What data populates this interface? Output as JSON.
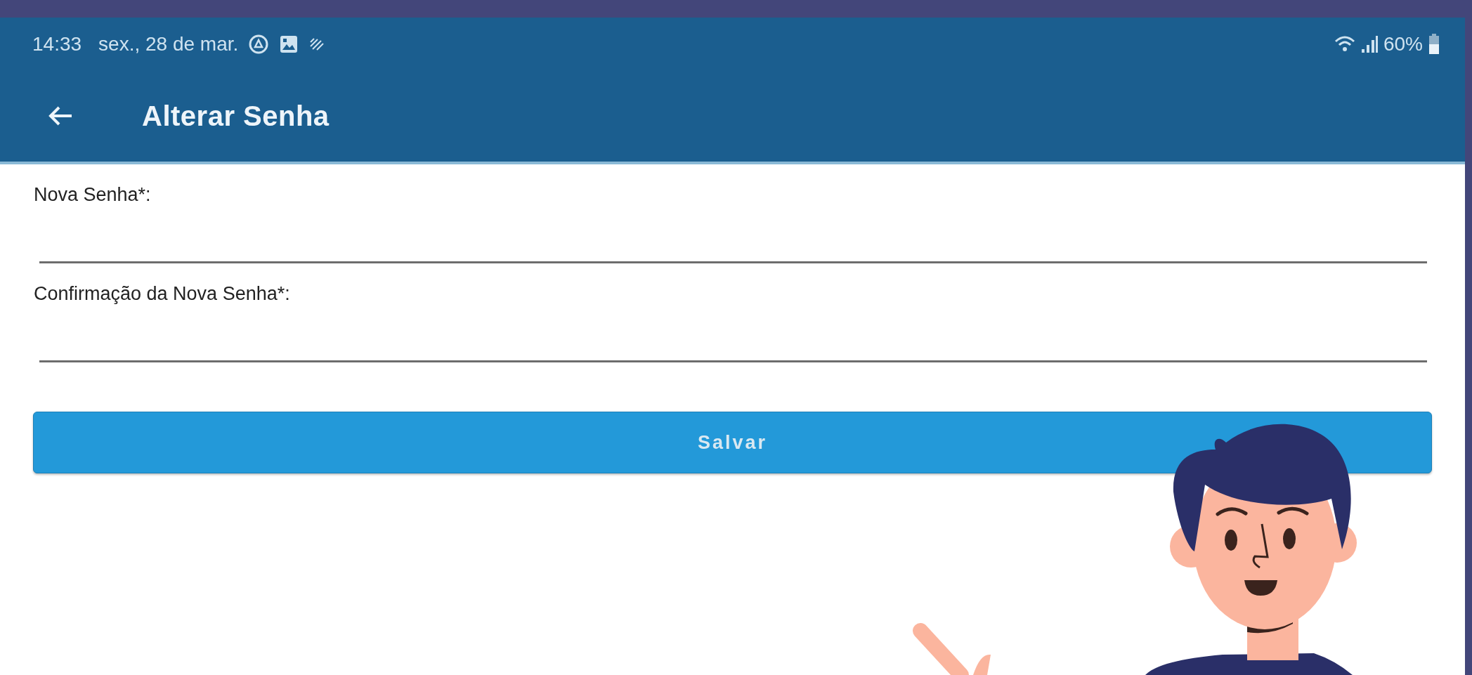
{
  "status_bar": {
    "time": "14:33",
    "date": "sex., 28 de mar.",
    "battery": "60%"
  },
  "toolbar": {
    "title": "Alterar Senha"
  },
  "fields": [
    {
      "label": "Nova Senha*:"
    },
    {
      "label": "Confirmação da Nova Senha*:"
    }
  ],
  "buttons": [
    "Salvar"
  ]
}
